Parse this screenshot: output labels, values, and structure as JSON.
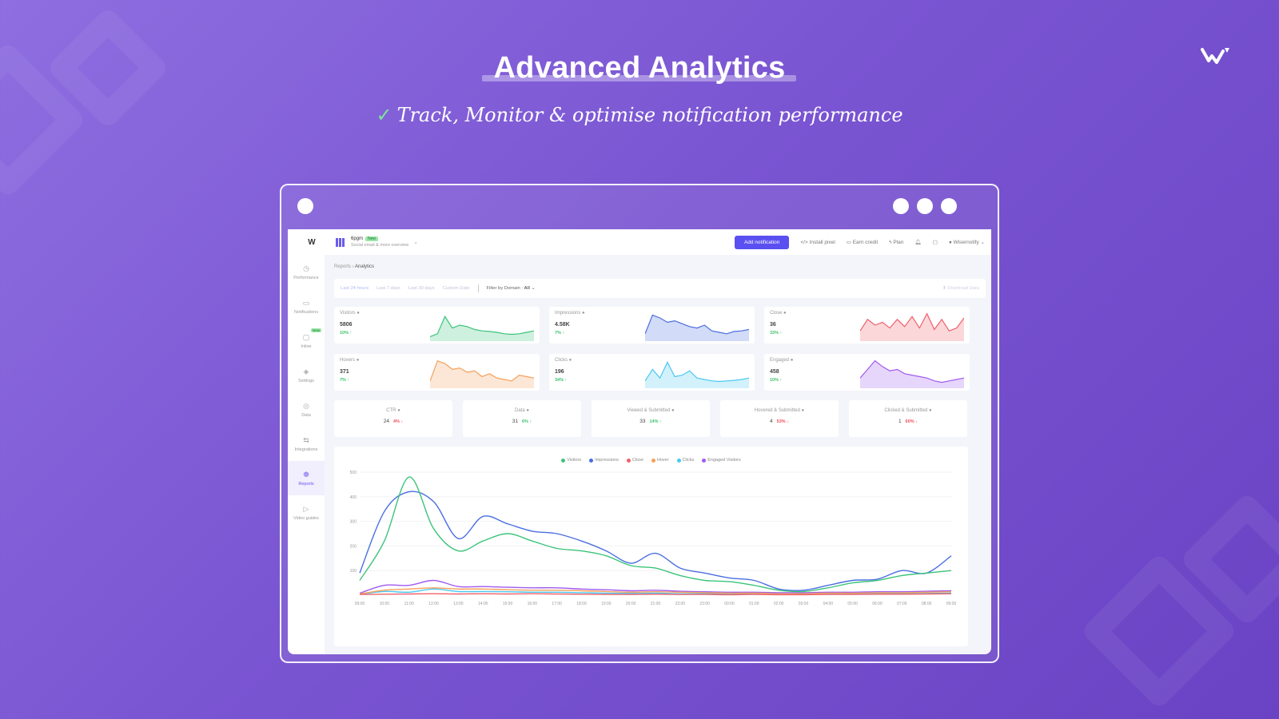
{
  "hero": {
    "title": "Advanced Analytics",
    "subtitle": "Track, Monitor & optimise notification performance",
    "check_icon": "✓"
  },
  "app": {
    "logo": "W",
    "workspace": {
      "name": "6pgm",
      "badge": "New",
      "desc": "Social email & more overview"
    },
    "topbar": {
      "add_button": "Add notification",
      "install_pixel": "Install pixel",
      "earn_credit": "Earn credit",
      "plan": "Plan",
      "user": "Wisernotify"
    },
    "sidebar": [
      {
        "label": "Performance",
        "icon": "◷"
      },
      {
        "label": "Notifications",
        "icon": "▭"
      },
      {
        "label": "Inline",
        "icon": "▢",
        "badge": "New"
      },
      {
        "label": "Settings",
        "icon": "◈"
      },
      {
        "label": "Data",
        "icon": "◎"
      },
      {
        "label": "Integrations",
        "icon": "⇆"
      },
      {
        "label": "Reports",
        "icon": "❁",
        "active": true
      },
      {
        "label": "Video guides",
        "icon": "▷"
      }
    ],
    "breadcrumb": {
      "parent": "Reports",
      "sep": "›",
      "current": "Analytics"
    },
    "filters": {
      "ranges": [
        "Last 24 hours",
        "Last 7 days",
        "Last 30 days",
        "Custom Date"
      ],
      "domain_label": "Filter by Domain :",
      "domain_value": "All",
      "download": "Download Data"
    },
    "stats": [
      {
        "label": "Visitors",
        "value": "5806",
        "change": "10%",
        "dir": "up",
        "color": "#3cc47a"
      },
      {
        "label": "Impressions",
        "value": "4.58K",
        "change": "7%",
        "dir": "up",
        "color": "#4a6ee0"
      },
      {
        "label": "Close",
        "value": "36",
        "change": "33%",
        "dir": "up",
        "color": "#f0606a"
      },
      {
        "label": "Hovers",
        "value": "371",
        "change": "7%",
        "dir": "up",
        "color": "#f5a05a"
      },
      {
        "label": "Clicks",
        "value": "196",
        "change": "34%",
        "dir": "up",
        "color": "#4ac8f0"
      },
      {
        "label": "Engaged",
        "value": "458",
        "change": "10%",
        "dir": "up",
        "color": "#a05af0"
      }
    ],
    "kpis": [
      {
        "label": "CTR",
        "value": "24",
        "change": "4%",
        "dir": "down"
      },
      {
        "label": "Data",
        "value": "31",
        "change": "6%",
        "dir": "up"
      },
      {
        "label": "Viewed & Submitted",
        "value": "33",
        "change": "14%",
        "dir": "up"
      },
      {
        "label": "Hovered & Submitted",
        "value": "4",
        "change": "53%",
        "dir": "down"
      },
      {
        "label": "Clicked & Submitted",
        "value": "1",
        "change": "60%",
        "dir": "down"
      }
    ]
  },
  "chart_data": {
    "type": "line",
    "legend": [
      "Visitors",
      "Impressions",
      "Close",
      "Hover",
      "Clicks",
      "Engaged Visitors"
    ],
    "colors": [
      "#3cc47a",
      "#4a6ee0",
      "#f0606a",
      "#f5a05a",
      "#4ac8f0",
      "#a05af0"
    ],
    "x": [
      "09:00",
      "10:00",
      "11:00",
      "12:00",
      "13:00",
      "14:00",
      "15:00",
      "16:00",
      "17:00",
      "18:00",
      "19:00",
      "20:00",
      "21:00",
      "22:00",
      "23:00",
      "00:00",
      "01:00",
      "02:00",
      "03:00",
      "04:00",
      "05:00",
      "06:00",
      "07:00",
      "08:00",
      "09:00"
    ],
    "ylim": [
      0,
      500
    ],
    "yticks": [
      100,
      200,
      300,
      400,
      500
    ],
    "series": [
      {
        "name": "Visitors",
        "values": [
          60,
          220,
          480,
          270,
          180,
          220,
          250,
          220,
          190,
          180,
          160,
          120,
          110,
          80,
          60,
          55,
          40,
          20,
          15,
          30,
          50,
          60,
          80,
          90,
          100
        ]
      },
      {
        "name": "Impressions",
        "values": [
          90,
          340,
          420,
          380,
          230,
          320,
          290,
          260,
          250,
          220,
          180,
          130,
          170,
          110,
          90,
          70,
          60,
          25,
          20,
          40,
          60,
          65,
          100,
          90,
          160
        ]
      },
      {
        "name": "Close",
        "values": [
          3,
          4,
          5,
          6,
          5,
          6,
          5,
          6,
          5,
          4,
          3,
          3,
          4,
          3,
          3,
          2,
          3,
          2,
          2,
          3,
          3,
          4,
          4,
          5,
          6
        ]
      },
      {
        "name": "Hover",
        "values": [
          5,
          20,
          25,
          30,
          25,
          25,
          22,
          20,
          20,
          18,
          15,
          12,
          14,
          12,
          10,
          8,
          8,
          6,
          6,
          8,
          8,
          10,
          10,
          12,
          14
        ]
      },
      {
        "name": "Clicks",
        "values": [
          4,
          15,
          12,
          25,
          15,
          15,
          14,
          12,
          12,
          10,
          8,
          7,
          8,
          6,
          6,
          5,
          5,
          4,
          4,
          5,
          5,
          6,
          6,
          7,
          8
        ]
      },
      {
        "name": "Engaged Visitors",
        "values": [
          8,
          40,
          40,
          60,
          35,
          35,
          32,
          30,
          30,
          25,
          22,
          18,
          20,
          16,
          14,
          12,
          12,
          10,
          10,
          12,
          12,
          14,
          14,
          16,
          18
        ]
      }
    ],
    "sparklines": {
      "Visitors": [
        10,
        20,
        80,
        40,
        50,
        45,
        35,
        30,
        28,
        25,
        20,
        18,
        20,
        25,
        30
      ],
      "Impressions": [
        20,
        85,
        75,
        60,
        65,
        55,
        45,
        40,
        50,
        30,
        25,
        20,
        28,
        30,
        35
      ],
      "Close": [
        30,
        70,
        50,
        60,
        40,
        70,
        45,
        80,
        40,
        90,
        35,
        70,
        30,
        40,
        75
      ],
      "Hovers": [
        20,
        90,
        80,
        60,
        65,
        50,
        55,
        35,
        45,
        30,
        25,
        20,
        40,
        35,
        30
      ],
      "Clicks": [
        20,
        60,
        30,
        85,
        35,
        40,
        55,
        30,
        25,
        20,
        18,
        20,
        22,
        25,
        30
      ],
      "Engaged": [
        30,
        60,
        90,
        70,
        55,
        60,
        45,
        40,
        35,
        30,
        20,
        15,
        20,
        25,
        30
      ]
    }
  }
}
